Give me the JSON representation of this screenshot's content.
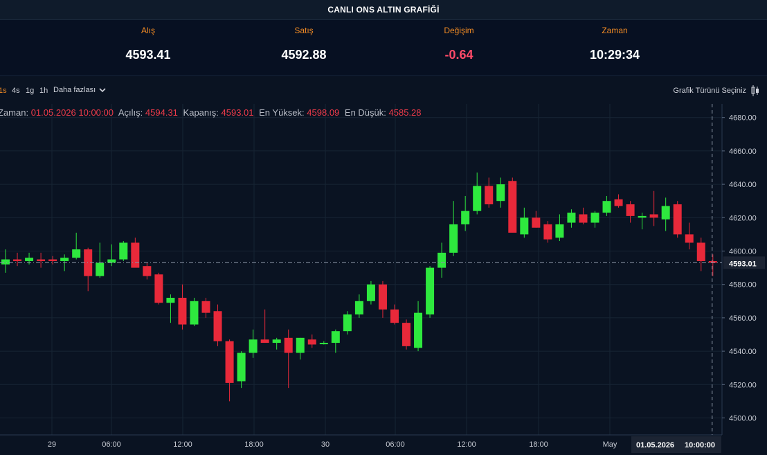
{
  "header": {
    "title": "CANLI ONS ALTIN GRAFİĞİ"
  },
  "quotes": [
    {
      "label": "Alış",
      "value": "4593.41"
    },
    {
      "label": "Satış",
      "value": "4592.88"
    },
    {
      "label": "Değişim",
      "value": "-0.64"
    },
    {
      "label": "Zaman",
      "value": "10:29:34"
    }
  ],
  "toolbar": {
    "timeframes": [
      "1s",
      "4s",
      "1g",
      "1h"
    ],
    "active_timeframe": "1s",
    "more_label": "Daha fazlası",
    "chart_type_label": "Grafik Türünü Seçiniz"
  },
  "legend": {
    "time_label": "Zaman:",
    "time_value": "01.05.2026 10:00:00",
    "open_label": "Açılış:",
    "open_value": "4594.31",
    "close_label": "Kapanış:",
    "close_value": "4593.01",
    "high_label": "En Yüksek:",
    "high_value": "4598.09",
    "low_label": "En Düşük:",
    "low_value": "4585.28"
  },
  "colors": {
    "up": "#2ee83e",
    "down": "#e8293a",
    "accent": "#f08a24",
    "background": "#0a1322"
  },
  "chart_data": {
    "type": "candlestick",
    "ylim": [
      4490,
      4690
    ],
    "y_ticks": [
      "4500.00",
      "4520.00",
      "4540.00",
      "4560.00",
      "4580.00",
      "4600.00",
      "4620.00",
      "4640.00",
      "4660.00",
      "4680.00"
    ],
    "x_tick_labels": [
      "29",
      "06:00",
      "12:00",
      "18:00",
      "30",
      "06:00",
      "12:00",
      "18:00",
      "May"
    ],
    "crosshair": {
      "price_label": "4593.01",
      "date_label": "01.05.2026",
      "time_label": "10:00:00"
    },
    "candles": [
      {
        "o": 4592,
        "h": 4601,
        "l": 4587,
        "c": 4595
      },
      {
        "o": 4595,
        "h": 4599,
        "l": 4591,
        "c": 4594
      },
      {
        "o": 4594,
        "h": 4599,
        "l": 4592,
        "c": 4596
      },
      {
        "o": 4595,
        "h": 4599,
        "l": 4590,
        "c": 4594
      },
      {
        "o": 4595,
        "h": 4597,
        "l": 4592,
        "c": 4594
      },
      {
        "o": 4594,
        "h": 4598,
        "l": 4588,
        "c": 4596
      },
      {
        "o": 4596,
        "h": 4611,
        "l": 4595,
        "c": 4601
      },
      {
        "o": 4601,
        "h": 4602,
        "l": 4576,
        "c": 4585
      },
      {
        "o": 4585,
        "h": 4605,
        "l": 4584,
        "c": 4593
      },
      {
        "o": 4593,
        "h": 4604,
        "l": 4591,
        "c": 4595
      },
      {
        "o": 4595,
        "h": 4606,
        "l": 4594,
        "c": 4605
      },
      {
        "o": 4605,
        "h": 4608,
        "l": 4591,
        "c": 4590
      },
      {
        "o": 4591,
        "h": 4593,
        "l": 4583,
        "c": 4585
      },
      {
        "o": 4586,
        "h": 4587,
        "l": 4568,
        "c": 4569
      },
      {
        "o": 4569,
        "h": 4574,
        "l": 4557,
        "c": 4572
      },
      {
        "o": 4572,
        "h": 4580,
        "l": 4553,
        "c": 4556
      },
      {
        "o": 4556,
        "h": 4572,
        "l": 4555,
        "c": 4570
      },
      {
        "o": 4570,
        "h": 4572,
        "l": 4560,
        "c": 4563
      },
      {
        "o": 4564,
        "h": 4568,
        "l": 4543,
        "c": 4546
      },
      {
        "o": 4546,
        "h": 4547,
        "l": 4510,
        "c": 4521
      },
      {
        "o": 4522,
        "h": 4540,
        "l": 4518,
        "c": 4539
      },
      {
        "o": 4539,
        "h": 4553,
        "l": 4536,
        "c": 4547
      },
      {
        "o": 4547,
        "h": 4565,
        "l": 4545,
        "c": 4545
      },
      {
        "o": 4545,
        "h": 4548,
        "l": 4541,
        "c": 4547
      },
      {
        "o": 4548,
        "h": 4553,
        "l": 4518,
        "c": 4539
      },
      {
        "o": 4539,
        "h": 4548,
        "l": 4535,
        "c": 4548
      },
      {
        "o": 4547,
        "h": 4550,
        "l": 4542,
        "c": 4544
      },
      {
        "o": 4545,
        "h": 4546,
        "l": 4544,
        "c": 4545
      },
      {
        "o": 4545,
        "h": 4553,
        "l": 4539,
        "c": 4552
      },
      {
        "o": 4552,
        "h": 4564,
        "l": 4550,
        "c": 4562
      },
      {
        "o": 4562,
        "h": 4574,
        "l": 4560,
        "c": 4570
      },
      {
        "o": 4570,
        "h": 4582,
        "l": 4568,
        "c": 4580
      },
      {
        "o": 4580,
        "h": 4582,
        "l": 4560,
        "c": 4565
      },
      {
        "o": 4565,
        "h": 4568,
        "l": 4556,
        "c": 4557
      },
      {
        "o": 4557,
        "h": 4559,
        "l": 4541,
        "c": 4543
      },
      {
        "o": 4542,
        "h": 4570,
        "l": 4540,
        "c": 4563
      },
      {
        "o": 4562,
        "h": 4591,
        "l": 4560,
        "c": 4590
      },
      {
        "o": 4590,
        "h": 4605,
        "l": 4584,
        "c": 4599
      },
      {
        "o": 4599,
        "h": 4630,
        "l": 4597,
        "c": 4616
      },
      {
        "o": 4616,
        "h": 4633,
        "l": 4612,
        "c": 4624
      },
      {
        "o": 4624,
        "h": 4647,
        "l": 4622,
        "c": 4639
      },
      {
        "o": 4639,
        "h": 4644,
        "l": 4626,
        "c": 4628
      },
      {
        "o": 4630,
        "h": 4644,
        "l": 4626,
        "c": 4640
      },
      {
        "o": 4642,
        "h": 4644,
        "l": 4611,
        "c": 4611
      },
      {
        "o": 4610,
        "h": 4626,
        "l": 4608,
        "c": 4620
      },
      {
        "o": 4620,
        "h": 4624,
        "l": 4614,
        "c": 4614
      },
      {
        "o": 4616,
        "h": 4618,
        "l": 4605,
        "c": 4607
      },
      {
        "o": 4608,
        "h": 4622,
        "l": 4606,
        "c": 4616
      },
      {
        "o": 4617,
        "h": 4625,
        "l": 4614,
        "c": 4623
      },
      {
        "o": 4622,
        "h": 4626,
        "l": 4616,
        "c": 4617
      },
      {
        "o": 4617,
        "h": 4624,
        "l": 4614,
        "c": 4623
      },
      {
        "o": 4623,
        "h": 4633,
        "l": 4621,
        "c": 4630
      },
      {
        "o": 4631,
        "h": 4634,
        "l": 4626,
        "c": 4627
      },
      {
        "o": 4628,
        "h": 4630,
        "l": 4617,
        "c": 4621
      },
      {
        "o": 4620,
        "h": 4623,
        "l": 4613,
        "c": 4621
      },
      {
        "o": 4622,
        "h": 4636,
        "l": 4615,
        "c": 4620
      },
      {
        "o": 4619,
        "h": 4632,
        "l": 4612,
        "c": 4627
      },
      {
        "o": 4628,
        "h": 4630,
        "l": 4608,
        "c": 4610
      },
      {
        "o": 4610,
        "h": 4617,
        "l": 4601,
        "c": 4605
      },
      {
        "o": 4605,
        "h": 4608,
        "l": 4588,
        "c": 4594
      },
      {
        "o": 4594,
        "h": 4598,
        "l": 4585,
        "c": 4593
      }
    ]
  }
}
